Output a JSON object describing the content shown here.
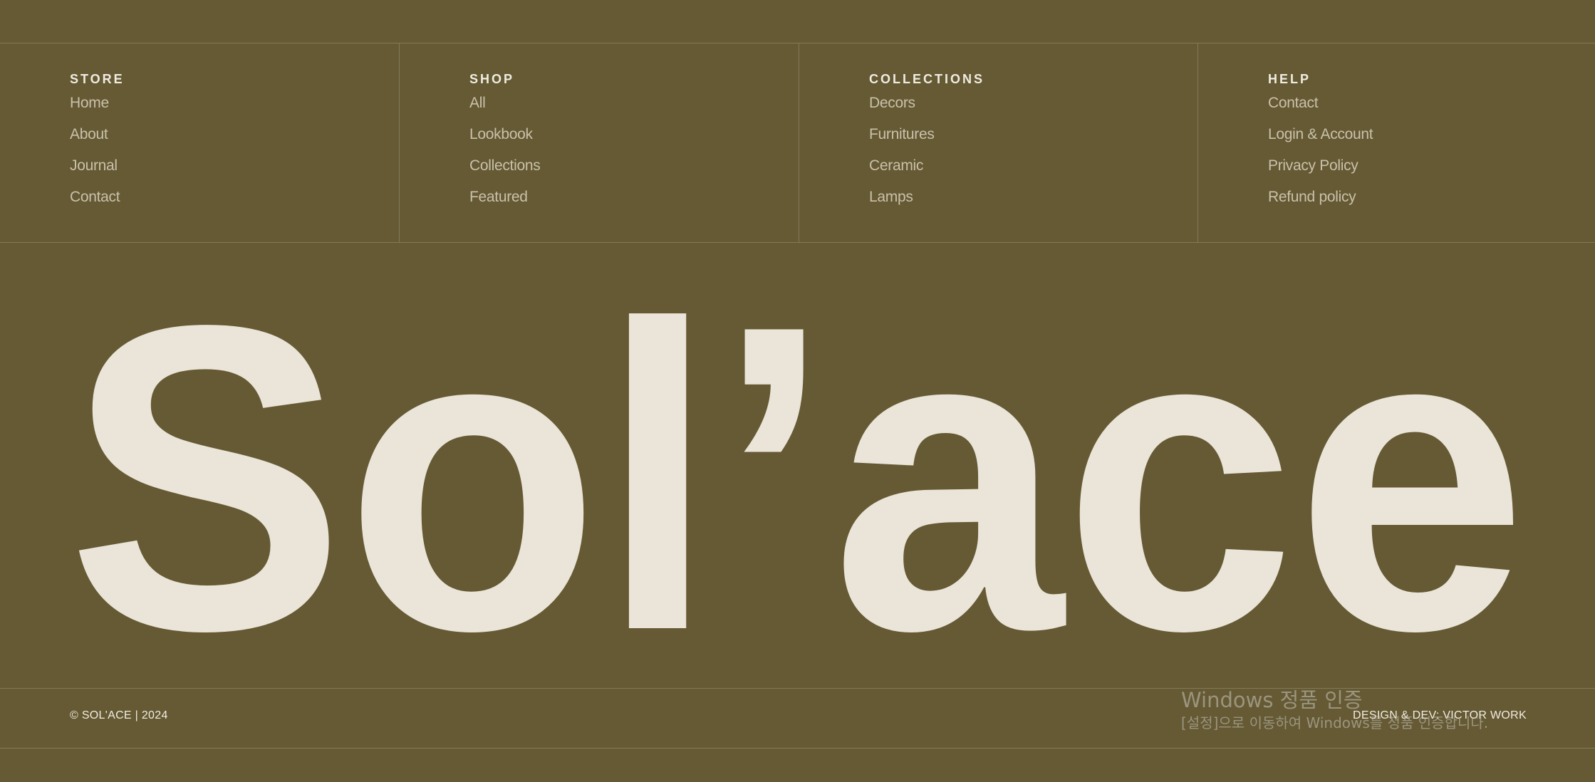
{
  "footer_nav": {
    "columns": [
      {
        "heading": "STORE",
        "links": [
          "Home",
          "About",
          "Journal",
          "Contact"
        ]
      },
      {
        "heading": "SHOP",
        "links": [
          "All",
          "Lookbook",
          "Collections",
          "Featured"
        ]
      },
      {
        "heading": "COLLECTIONS",
        "links": [
          "Decors",
          "Furnitures",
          "Ceramic",
          "Lamps"
        ]
      },
      {
        "heading": "HELP",
        "links": [
          "Contact",
          "Login & Account",
          "Privacy Policy",
          "Refund policy"
        ]
      }
    ]
  },
  "brand": {
    "wordmark": "Sol’ace"
  },
  "bottom_bar": {
    "copyright": "© SOL'ACE | 2024",
    "credit": "DESIGN & DEV: VICTOR WORK"
  },
  "windows_activation": {
    "title": "Windows 정품 인증",
    "subtitle": "[설정]으로 이동하여 Windows를 정품 인증합니다."
  },
  "colors": {
    "background": "#655a34",
    "text_light": "#ebe5d9",
    "link_muted": "#c9c1ab",
    "divider": "#837a57"
  }
}
